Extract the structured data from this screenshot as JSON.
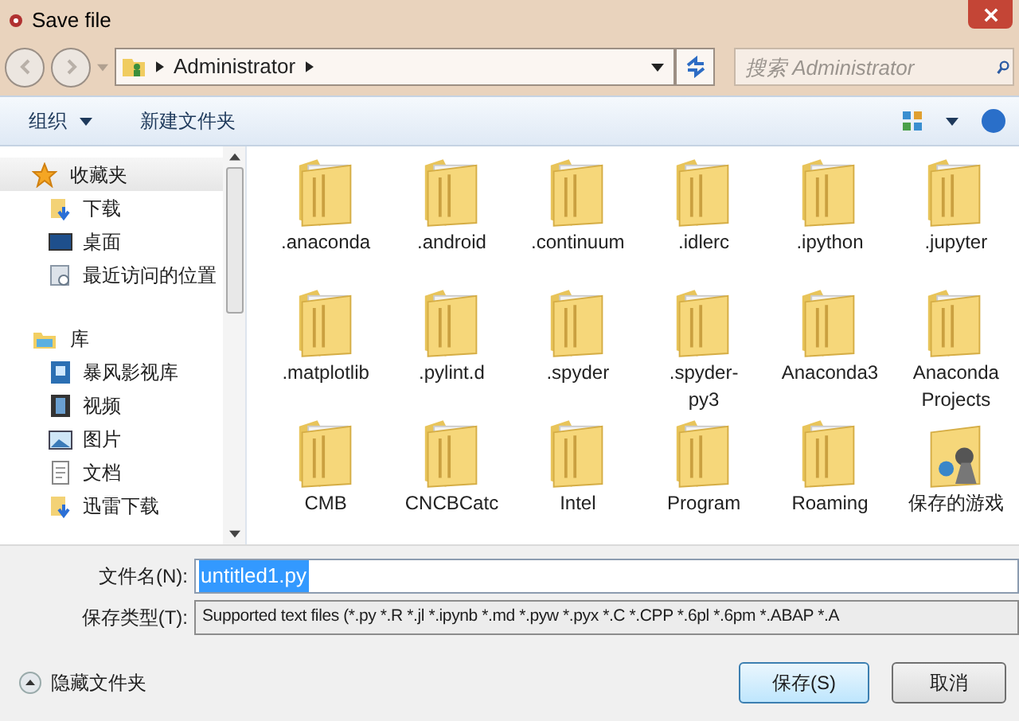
{
  "window": {
    "title": "Save file"
  },
  "address_bar": {
    "path": [
      "Administrator"
    ],
    "search_placeholder": "搜索 Administrator"
  },
  "toolbar": {
    "organize": "组织",
    "new_folder": "新建文件夹"
  },
  "sidebar": {
    "groups": [
      {
        "label": "收藏夹",
        "selected": true,
        "children": [
          {
            "label": "下载"
          },
          {
            "label": "桌面"
          },
          {
            "label": "最近访问的位置"
          }
        ]
      },
      {
        "label": "库",
        "selected": false,
        "children": [
          {
            "label": "暴风影视库"
          },
          {
            "label": "视频"
          },
          {
            "label": "图片"
          },
          {
            "label": "文档"
          },
          {
            "label": "迅雷下载"
          }
        ]
      }
    ]
  },
  "files": [
    {
      "name": ".anaconda",
      "kind": "folder"
    },
    {
      "name": ".android",
      "kind": "folder"
    },
    {
      "name": ".continuum",
      "kind": "folder"
    },
    {
      "name": ".idlerc",
      "kind": "folder"
    },
    {
      "name": ".ipython",
      "kind": "folder"
    },
    {
      "name": ".jupyter",
      "kind": "folder"
    },
    {
      "name": ".matplotlib",
      "kind": "folder"
    },
    {
      "name": ".pylint.d",
      "kind": "folder"
    },
    {
      "name": ".spyder",
      "kind": "folder"
    },
    {
      "name": ".spyder-py3",
      "kind": "folder"
    },
    {
      "name": "Anaconda3",
      "kind": "folder"
    },
    {
      "name": "Anaconda Projects",
      "kind": "folder"
    },
    {
      "name": "CMB",
      "kind": "folder"
    },
    {
      "name": "CNCBCatc",
      "kind": "folder"
    },
    {
      "name": "Intel",
      "kind": "folder"
    },
    {
      "name": "Program",
      "kind": "folder"
    },
    {
      "name": "Roaming",
      "kind": "folder"
    },
    {
      "name": "保存的游戏",
      "kind": "games"
    }
  ],
  "form": {
    "filename_label": "文件名(N):",
    "filename": "untitled1.py",
    "type_label": "保存类型(T):",
    "type_value": "Supported text files (*.py *.R *.jl *.ipynb *.md *.pyw *.pyx *.C *.CPP *.6pl *.6pm *.ABAP *.A"
  },
  "footer": {
    "hide_folders": "隐藏文件夹",
    "save": "保存(S)",
    "cancel": "取消"
  }
}
